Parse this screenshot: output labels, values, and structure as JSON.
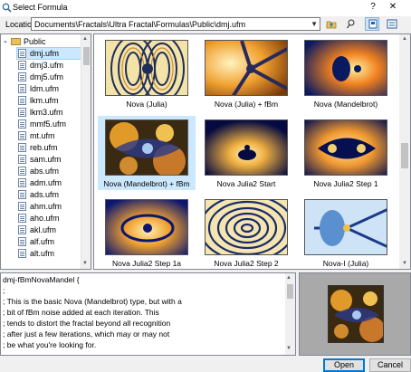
{
  "window": {
    "title": "Select Formula",
    "help_label": "?",
    "close_label": "✕"
  },
  "location": {
    "label": "Location:",
    "value": "Documents\\Fractals\\Ultra Fractal\\Formulas\\Public\\dmj.ufm"
  },
  "toolbar": {
    "icons": [
      "folder-up-icon",
      "find-icon",
      "view-thumbnails-icon",
      "view-list-icon"
    ],
    "active": "view-thumbnails-icon"
  },
  "tree": {
    "root_label": "Public",
    "files": [
      "dmj.ufm",
      "dmj3.ufm",
      "dmj5.ufm",
      "ldm.ufm",
      "lkm.ufm",
      "lkm3.ufm",
      "mmf5.ufm",
      "mt.ufm",
      "reb.ufm",
      "sam.ufm",
      "abs.ufm",
      "adm.ufm",
      "ads.ufm",
      "ahm.ufm",
      "aho.ufm",
      "akl.ufm",
      "alf.ufm",
      "alt.ufm"
    ],
    "selected": "dmj.ufm"
  },
  "gallery": {
    "items": [
      {
        "label": "Nova (Julia)"
      },
      {
        "label": "Nova (Julia) + fBm"
      },
      {
        "label": "Nova (Mandelbrot)"
      },
      {
        "label": "Nova (Mandelbrot) + fBm"
      },
      {
        "label": "Nova Julia2 Start"
      },
      {
        "label": "Nova Julia2 Step 1"
      },
      {
        "label": "Nova Julia2 Step 1a"
      },
      {
        "label": "Nova Julia2 Step 2"
      },
      {
        "label": "Nova-I (Julia)"
      }
    ],
    "selected": "Nova (Mandelbrot) + fBm",
    "colors": {
      "selection": "#cce8ff"
    }
  },
  "description": {
    "lines": [
      "dmj-fBmNovaMandel {",
      ";",
      "; This is the basic Nova (Mandelbrot) type, but with a",
      "; bit of fBm noise added at each iteration. This",
      "; tends to distort the fractal beyond all recognition",
      "; after just a few iterations, which may or may not",
      "; be what you're looking for."
    ]
  },
  "buttons": {
    "open": "Open",
    "cancel": "Cancel"
  }
}
